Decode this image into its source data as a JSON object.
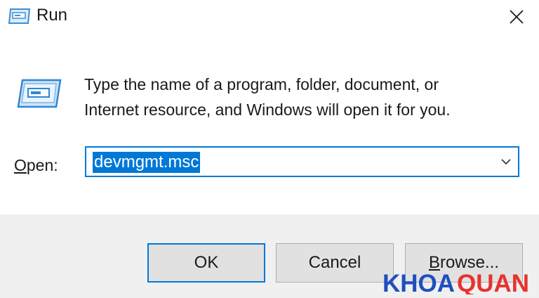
{
  "window": {
    "title": "Run",
    "close_symbol": "×"
  },
  "dialog": {
    "description_line1": "Type the name of a program, folder, document, or",
    "description_line2": "Internet resource, and Windows will open it for you.",
    "open_label_accel": "O",
    "open_label_rest": "pen:",
    "open_value": "devmgmt.msc"
  },
  "buttons": {
    "ok": "OK",
    "cancel": "Cancel",
    "browse_accel": "B",
    "browse_rest": "rowse..."
  },
  "watermark": {
    "text_part1": "KHOA",
    "text_part2": "QUAN"
  },
  "icons": {
    "title": "run-icon",
    "dialog": "run-icon",
    "combo_arrow": "chevron-down-icon",
    "close": "close-icon"
  },
  "colors": {
    "accent": "#0078d7",
    "footer_bg": "#f0f0f0",
    "button_bg": "#e1e1e1",
    "watermark_blue": "#1f4fc0",
    "watermark_red": "#e8322d"
  }
}
